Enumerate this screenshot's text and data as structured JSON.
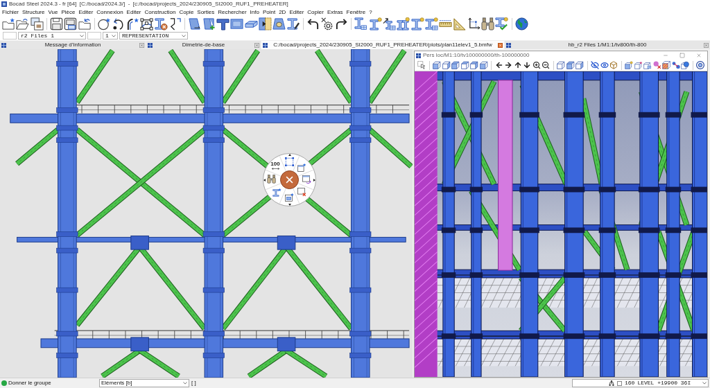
{
  "window": {
    "title": "Bocad Steel 2024.3 - fr [64]  [C:/bocad/2024.3/]  -  [c:/bocad/projects_2024/230905_SI2000_RUF1_PREHEATER]"
  },
  "menu": [
    "Fichier",
    "Structure",
    "Vue",
    "Pièce",
    "Editer",
    "Connexion",
    "Editer",
    "Construction",
    "Copie",
    "Sorties",
    "Rechercher",
    "Info",
    "Point",
    "2D",
    "Editer",
    "Copier",
    "Extras",
    "Fenêtre",
    "?"
  ],
  "selectors": [
    {
      "kind": "blank"
    },
    {
      "kind": "combo",
      "value": "r2 Files 1"
    },
    {
      "kind": "blank"
    },
    {
      "kind": "combo",
      "value": "1"
    },
    {
      "kind": "combo",
      "value": "REPRESENTATION"
    }
  ],
  "tabs": [
    {
      "label": "Message d'Information",
      "selected": false
    },
    {
      "label": "Dimetrie-de-base",
      "selected": false
    },
    {
      "label": "C:/bocad/projects_2024/230905_SI2000_RUF1_PREHEATER/plots/plan11elev1_5.bmfw",
      "selected": true
    },
    {
      "label": "hb_r2 Files 1/M1:1/tv800/th-800",
      "selected": false
    }
  ],
  "radial_menu": {
    "dimension_label": "100"
  },
  "view_window": {
    "title": "Pers loc/M1:10/tv100000000/th-100000000"
  },
  "status_bar": {
    "message": "Donner le groupe",
    "filter": "Eléments [b]",
    "selection": "[ ]",
    "checkbox_checked": false,
    "count": "160",
    "elevation": "LEVEL +19900 36I"
  }
}
